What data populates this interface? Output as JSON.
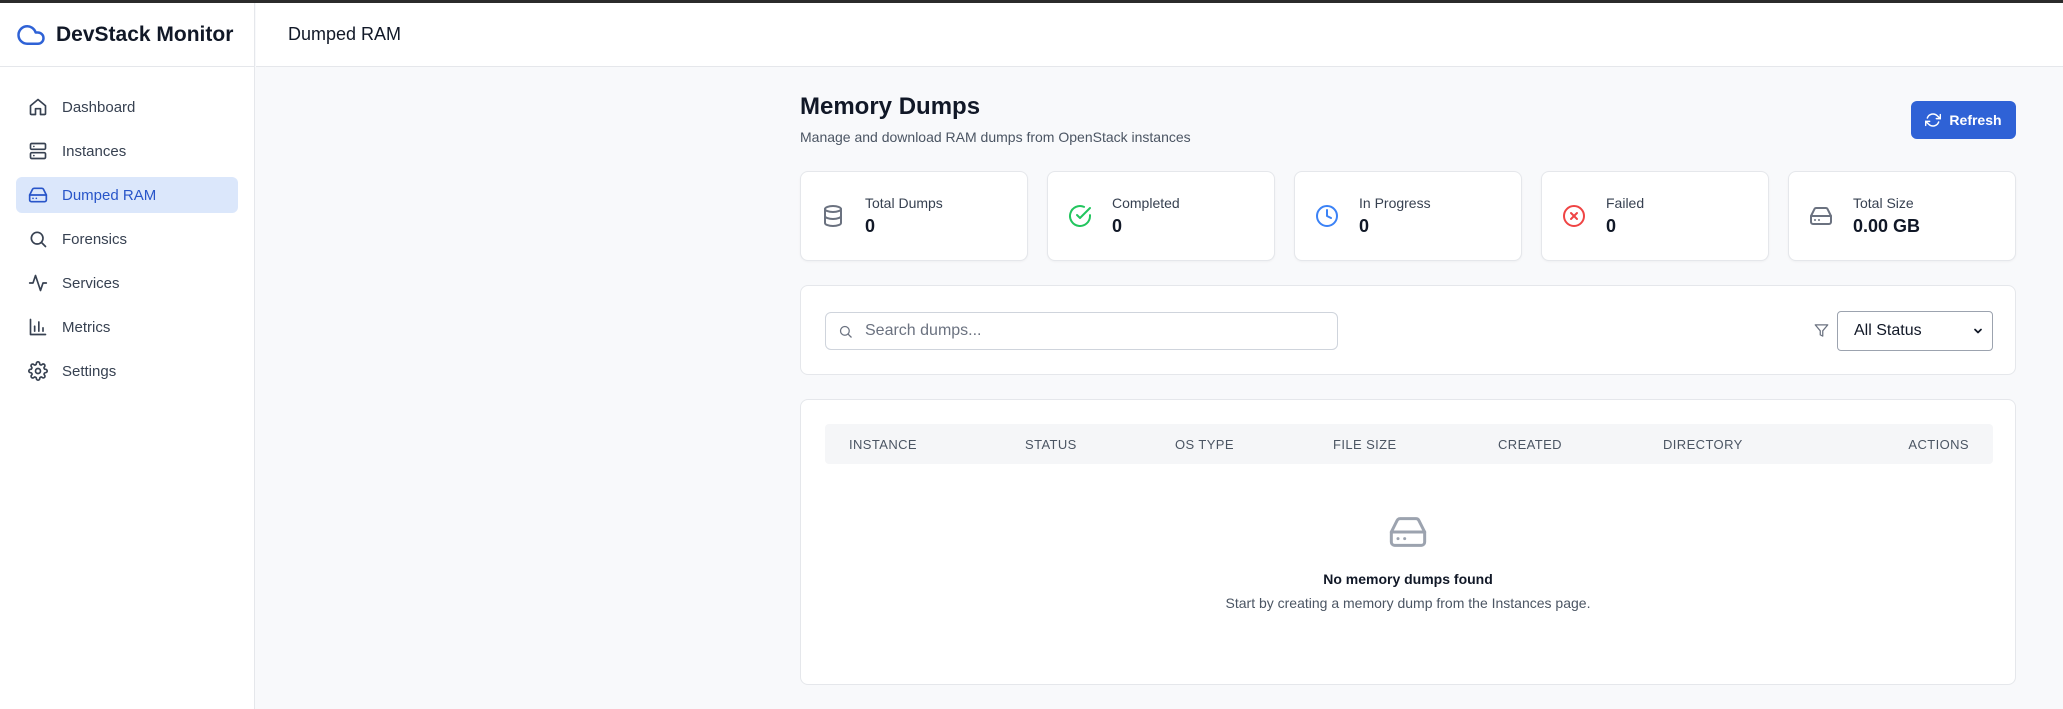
{
  "sidebar": {
    "brand": "DevStack Monitor",
    "items": [
      {
        "label": "Dashboard",
        "icon": "home-icon"
      },
      {
        "label": "Instances",
        "icon": "server-icon"
      },
      {
        "label": "Dumped RAM",
        "icon": "hard-drive-icon",
        "active": true
      },
      {
        "label": "Forensics",
        "icon": "search-icon"
      },
      {
        "label": "Services",
        "icon": "activity-icon"
      },
      {
        "label": "Metrics",
        "icon": "bar-chart-icon"
      },
      {
        "label": "Settings",
        "icon": "gear-icon"
      }
    ]
  },
  "header": {
    "title": "Dumped RAM"
  },
  "page": {
    "title": "Memory Dumps",
    "subtitle": "Manage and download RAM dumps from OpenStack instances",
    "refresh_label": "Refresh"
  },
  "stats": [
    {
      "label": "Total Dumps",
      "value": "0",
      "icon": "database-icon",
      "color": "#6b7280"
    },
    {
      "label": "Completed",
      "value": "0",
      "icon": "check-circle-icon",
      "color": "#22c55e"
    },
    {
      "label": "In Progress",
      "value": "0",
      "icon": "clock-icon",
      "color": "#3b82f6"
    },
    {
      "label": "Failed",
      "value": "0",
      "icon": "x-circle-icon",
      "color": "#ef4444"
    },
    {
      "label": "Total Size",
      "value": "0.00 GB",
      "icon": "hard-drive-icon",
      "color": "#6b7280"
    }
  ],
  "filter": {
    "search_placeholder": "Search dumps...",
    "status_selected": "All Status"
  },
  "table": {
    "columns": [
      "INSTANCE",
      "STATUS",
      "OS TYPE",
      "FILE SIZE",
      "CREATED",
      "DIRECTORY",
      "ACTIONS"
    ],
    "empty_title": "No memory dumps found",
    "empty_subtitle": "Start by creating a memory dump from the Instances page."
  },
  "colors": {
    "accent": "#2f62d6",
    "active_nav_bg": "#dbe7fb",
    "active_nav_text": "#2855c9"
  }
}
